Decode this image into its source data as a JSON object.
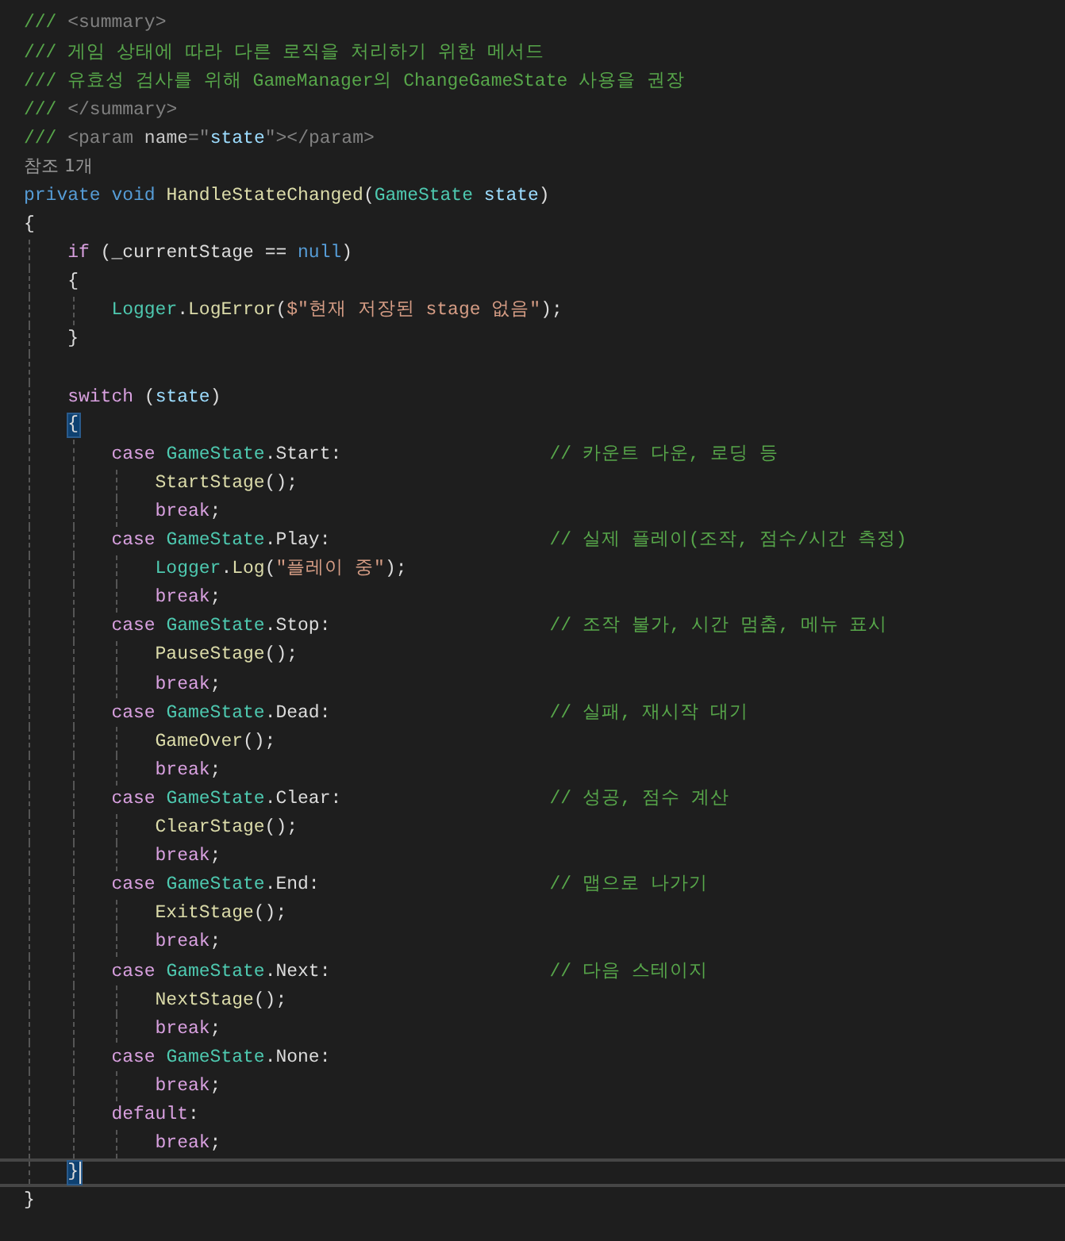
{
  "lines": [
    {
      "kind": "code",
      "current": false,
      "tokens": [
        {
          "kind": "doc",
          "text": "/// "
        },
        {
          "kind": "doctag",
          "text": "<summary>"
        }
      ]
    },
    {
      "kind": "code",
      "current": false,
      "tokens": [
        {
          "kind": "doc",
          "text": "/// 게임 상태에 따라 다른 로직을 처리하기 위한 메서드"
        }
      ]
    },
    {
      "kind": "code",
      "current": false,
      "tokens": [
        {
          "kind": "doc",
          "text": "/// 유효성 검사를 위해 GameManager의 ChangeGameState 사용을 권장"
        }
      ]
    },
    {
      "kind": "code",
      "current": false,
      "tokens": [
        {
          "kind": "doc",
          "text": "/// "
        },
        {
          "kind": "doctag",
          "text": "</summary>"
        }
      ]
    },
    {
      "kind": "code",
      "current": false,
      "tokens": [
        {
          "kind": "doc",
          "text": "/// "
        },
        {
          "kind": "doctag",
          "text": "<param "
        },
        {
          "kind": "docattr",
          "text": "name"
        },
        {
          "kind": "doctag",
          "text": "=\""
        },
        {
          "kind": "docvalue",
          "text": "state"
        },
        {
          "kind": "doctag",
          "text": "\"></param>"
        }
      ]
    },
    {
      "kind": "lens",
      "current": false,
      "text": "참조 1개"
    },
    {
      "kind": "code",
      "current": false,
      "tokens": [
        {
          "kind": "keyword",
          "text": "private void"
        },
        {
          "kind": "method",
          "text": " HandleStateChanged"
        },
        {
          "kind": "plain",
          "text": "("
        },
        {
          "kind": "type",
          "text": "GameState"
        },
        {
          "kind": "param",
          "text": " state"
        },
        {
          "kind": "plain",
          "text": ")"
        }
      ]
    },
    {
      "kind": "code",
      "current": false,
      "tokens": [
        {
          "kind": "plain",
          "text": "{"
        }
      ],
      "children": [
        {
          "kind": "code",
          "current": false,
          "tokens": [
            {
              "kind": "control",
              "text": "if"
            },
            {
              "kind": "plain",
              "text": " (_currentStage == "
            },
            {
              "kind": "keyword",
              "text": "null"
            },
            {
              "kind": "plain",
              "text": ")"
            }
          ]
        },
        {
          "kind": "code",
          "current": false,
          "tokens": [
            {
              "kind": "plain",
              "text": "{"
            }
          ],
          "children": [
            {
              "kind": "code",
              "current": false,
              "tokens": [
                {
                  "kind": "type",
                  "text": "Logger"
                },
                {
                  "kind": "plain",
                  "text": "."
                },
                {
                  "kind": "method",
                  "text": "LogError"
                },
                {
                  "kind": "plain",
                  "text": "("
                },
                {
                  "kind": "string",
                  "text": "$\"현재 저장된 stage 없음\""
                },
                {
                  "kind": "plain",
                  "text": ");"
                }
              ]
            }
          ]
        },
        {
          "kind": "code",
          "current": false,
          "tokens": [
            {
              "kind": "plain",
              "text": "}"
            }
          ]
        },
        {
          "kind": "blank",
          "current": false
        },
        {
          "kind": "code",
          "current": false,
          "tokens": [
            {
              "kind": "control",
              "text": "switch"
            },
            {
              "kind": "plain",
              "text": " ("
            },
            {
              "kind": "param",
              "text": "state"
            },
            {
              "kind": "plain",
              "text": ")"
            }
          ]
        },
        {
          "kind": "code",
          "current": false,
          "tokens": [
            {
              "kind": "brace-match",
              "text": "{"
            }
          ],
          "children": [
            {
              "kind": "code",
              "current": false,
              "tokens": [
                {
                  "kind": "control",
                  "text": "case"
                },
                {
                  "kind": "type",
                  "text": " GameState"
                },
                {
                  "kind": "plain",
                  "text": ".Start:"
                },
                {
                  "kind": "comment",
                  "text": "// 카운트 다운, 로딩 등"
                }
              ],
              "children": [
                {
                  "kind": "code",
                  "current": false,
                  "tokens": [
                    {
                      "kind": "method",
                      "text": "StartStage"
                    },
                    {
                      "kind": "plain",
                      "text": "();"
                    }
                  ]
                },
                {
                  "kind": "code",
                  "current": false,
                  "tokens": [
                    {
                      "kind": "control",
                      "text": "break"
                    },
                    {
                      "kind": "plain",
                      "text": ";"
                    }
                  ]
                }
              ]
            },
            {
              "kind": "code",
              "current": false,
              "tokens": [
                {
                  "kind": "control",
                  "text": "case"
                },
                {
                  "kind": "type",
                  "text": " GameState"
                },
                {
                  "kind": "plain",
                  "text": ".Play:"
                },
                {
                  "kind": "comment",
                  "text": "// 실제 플레이(조작, 점수/시간 측정)"
                }
              ],
              "children": [
                {
                  "kind": "code",
                  "current": false,
                  "tokens": [
                    {
                      "kind": "type",
                      "text": "Logger"
                    },
                    {
                      "kind": "plain",
                      "text": "."
                    },
                    {
                      "kind": "method",
                      "text": "Log"
                    },
                    {
                      "kind": "plain",
                      "text": "("
                    },
                    {
                      "kind": "string",
                      "text": "\"플레이 중\""
                    },
                    {
                      "kind": "plain",
                      "text": ");"
                    }
                  ]
                },
                {
                  "kind": "code",
                  "current": false,
                  "tokens": [
                    {
                      "kind": "control",
                      "text": "break"
                    },
                    {
                      "kind": "plain",
                      "text": ";"
                    }
                  ]
                }
              ]
            },
            {
              "kind": "code",
              "current": false,
              "tokens": [
                {
                  "kind": "control",
                  "text": "case"
                },
                {
                  "kind": "type",
                  "text": " GameState"
                },
                {
                  "kind": "plain",
                  "text": ".Stop:"
                },
                {
                  "kind": "comment",
                  "text": "// 조작 불가, 시간 멈춤, 메뉴 표시"
                }
              ],
              "children": [
                {
                  "kind": "code",
                  "current": false,
                  "tokens": [
                    {
                      "kind": "method",
                      "text": "PauseStage"
                    },
                    {
                      "kind": "plain",
                      "text": "();"
                    }
                  ]
                },
                {
                  "kind": "code",
                  "current": false,
                  "tokens": [
                    {
                      "kind": "control",
                      "text": "break"
                    },
                    {
                      "kind": "plain",
                      "text": ";"
                    }
                  ]
                }
              ]
            },
            {
              "kind": "code",
              "current": false,
              "tokens": [
                {
                  "kind": "control",
                  "text": "case"
                },
                {
                  "kind": "type",
                  "text": " GameState"
                },
                {
                  "kind": "plain",
                  "text": ".Dead:"
                },
                {
                  "kind": "comment",
                  "text": "// 실패, 재시작 대기"
                }
              ],
              "children": [
                {
                  "kind": "code",
                  "current": false,
                  "tokens": [
                    {
                      "kind": "method",
                      "text": "GameOver"
                    },
                    {
                      "kind": "plain",
                      "text": "();"
                    }
                  ]
                },
                {
                  "kind": "code",
                  "current": false,
                  "tokens": [
                    {
                      "kind": "control",
                      "text": "break"
                    },
                    {
                      "kind": "plain",
                      "text": ";"
                    }
                  ]
                }
              ]
            },
            {
              "kind": "code",
              "current": false,
              "tokens": [
                {
                  "kind": "control",
                  "text": "case"
                },
                {
                  "kind": "type",
                  "text": " GameState"
                },
                {
                  "kind": "plain",
                  "text": ".Clear:"
                },
                {
                  "kind": "comment",
                  "text": "// 성공, 점수 계산"
                }
              ],
              "children": [
                {
                  "kind": "code",
                  "current": false,
                  "tokens": [
                    {
                      "kind": "method",
                      "text": "ClearStage"
                    },
                    {
                      "kind": "plain",
                      "text": "();"
                    }
                  ]
                },
                {
                  "kind": "code",
                  "current": false,
                  "tokens": [
                    {
                      "kind": "control",
                      "text": "break"
                    },
                    {
                      "kind": "plain",
                      "text": ";"
                    }
                  ]
                }
              ]
            },
            {
              "kind": "code",
              "current": false,
              "tokens": [
                {
                  "kind": "control",
                  "text": "case"
                },
                {
                  "kind": "type",
                  "text": " GameState"
                },
                {
                  "kind": "plain",
                  "text": ".End:"
                },
                {
                  "kind": "comment",
                  "text": "// 맵으로 나가기"
                }
              ],
              "children": [
                {
                  "kind": "code",
                  "current": false,
                  "tokens": [
                    {
                      "kind": "method",
                      "text": "ExitStage"
                    },
                    {
                      "kind": "plain",
                      "text": "();"
                    }
                  ]
                },
                {
                  "kind": "code",
                  "current": false,
                  "tokens": [
                    {
                      "kind": "control",
                      "text": "break"
                    },
                    {
                      "kind": "plain",
                      "text": ";"
                    }
                  ]
                }
              ]
            },
            {
              "kind": "code",
              "current": false,
              "tokens": [
                {
                  "kind": "control",
                  "text": "case"
                },
                {
                  "kind": "type",
                  "text": " GameState"
                },
                {
                  "kind": "plain",
                  "text": ".Next:"
                },
                {
                  "kind": "comment",
                  "text": "// 다음 스테이지"
                }
              ],
              "children": [
                {
                  "kind": "code",
                  "current": false,
                  "tokens": [
                    {
                      "kind": "method",
                      "text": "NextStage"
                    },
                    {
                      "kind": "plain",
                      "text": "();"
                    }
                  ]
                },
                {
                  "kind": "code",
                  "current": false,
                  "tokens": [
                    {
                      "kind": "control",
                      "text": "break"
                    },
                    {
                      "kind": "plain",
                      "text": ";"
                    }
                  ]
                }
              ]
            },
            {
              "kind": "code",
              "current": false,
              "tokens": [
                {
                  "kind": "control",
                  "text": "case"
                },
                {
                  "kind": "type",
                  "text": " GameState"
                },
                {
                  "kind": "plain",
                  "text": ".None:"
                }
              ],
              "children": [
                {
                  "kind": "code",
                  "current": false,
                  "tokens": [
                    {
                      "kind": "control",
                      "text": "break"
                    },
                    {
                      "kind": "plain",
                      "text": ";"
                    }
                  ]
                }
              ]
            },
            {
              "kind": "code",
              "current": false,
              "tokens": [
                {
                  "kind": "control",
                  "text": "default"
                },
                {
                  "kind": "plain",
                  "text": ":"
                }
              ],
              "children": [
                {
                  "kind": "code",
                  "current": false,
                  "tokens": [
                    {
                      "kind": "control",
                      "text": "break"
                    },
                    {
                      "kind": "plain",
                      "text": ";"
                    }
                  ]
                }
              ]
            }
          ]
        },
        {
          "kind": "code",
          "current": true,
          "tokens": [
            {
              "kind": "brace-match",
              "text": "}"
            }
          ]
        }
      ]
    },
    {
      "kind": "code",
      "current": false,
      "tokens": [
        {
          "kind": "plain",
          "text": "}"
        }
      ]
    }
  ]
}
